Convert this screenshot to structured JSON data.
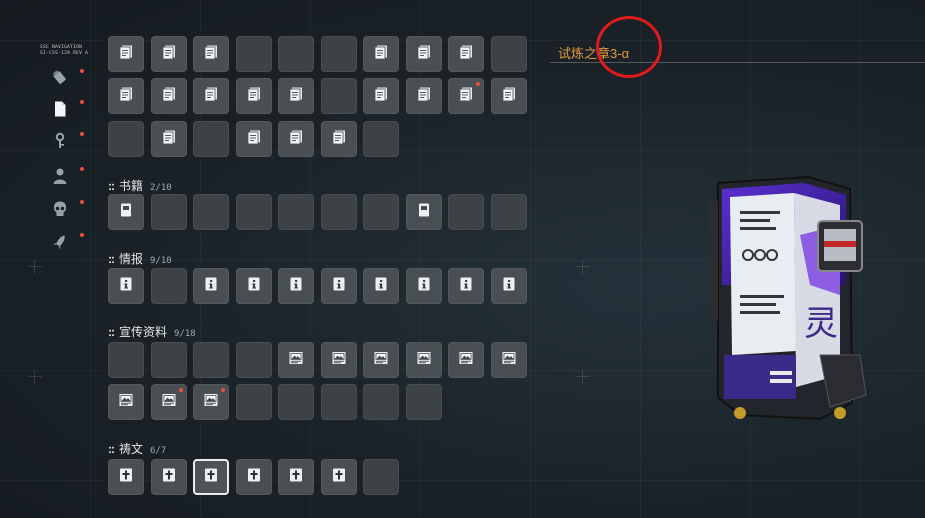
{
  "navigation": {
    "header_line1": "SSC NAVIGATION",
    "header_line2": "SI-CSS-128 REV A",
    "items": [
      {
        "icon": "usb-drive-icon",
        "badge": true
      },
      {
        "icon": "document-icon",
        "badge": true,
        "active": true
      },
      {
        "icon": "key-icon",
        "badge": true
      },
      {
        "icon": "person-icon",
        "badge": true
      },
      {
        "icon": "skull-icon",
        "badge": true
      },
      {
        "icon": "rocket-icon",
        "badge": true
      }
    ]
  },
  "top_grid": {
    "rows": [
      [
        "document",
        "document",
        "document",
        "empty",
        "empty",
        "empty",
        "document",
        "document",
        "document",
        "empty"
      ],
      [
        "document",
        "document",
        "document",
        "document",
        "document",
        "empty",
        "document",
        "document",
        "document",
        "document"
      ],
      [
        "empty",
        "document",
        "empty",
        "document",
        "document",
        "document",
        "empty"
      ]
    ],
    "badges": [
      [
        1,
        8
      ]
    ]
  },
  "sections": [
    {
      "label": "书籍",
      "count": "2/10",
      "slots": [
        "book",
        "empty",
        "empty",
        "empty",
        "empty",
        "empty",
        "empty",
        "book",
        "empty",
        "empty"
      ],
      "badges": [],
      "selected": []
    },
    {
      "label": "情报",
      "count": "9/10",
      "slots": [
        "info",
        "empty",
        "info",
        "info",
        "info",
        "info",
        "info",
        "info",
        "info",
        "info"
      ],
      "badges": [],
      "selected": []
    },
    {
      "label": "宣传资料",
      "count": "9/18",
      "slots": [
        "empty",
        "empty",
        "empty",
        "empty",
        "image",
        "image",
        "image",
        "image",
        "image",
        "image",
        "image",
        "image",
        "image",
        "empty",
        "empty",
        "empty",
        "empty",
        "empty"
      ],
      "badges": [
        11,
        12
      ],
      "selected": []
    },
    {
      "label": "祷文",
      "count": "6/7",
      "slots": [
        "cross",
        "cross",
        "cross",
        "cross",
        "cross",
        "cross",
        "empty"
      ],
      "badges": [],
      "selected": [
        2
      ]
    }
  ],
  "detail": {
    "title": "试炼之章3-",
    "title_suffix": "α",
    "artifact_icon": "access-card-artifact-icon",
    "accent_color": "#e39b3c",
    "highlight_color": "#e01b1b"
  }
}
